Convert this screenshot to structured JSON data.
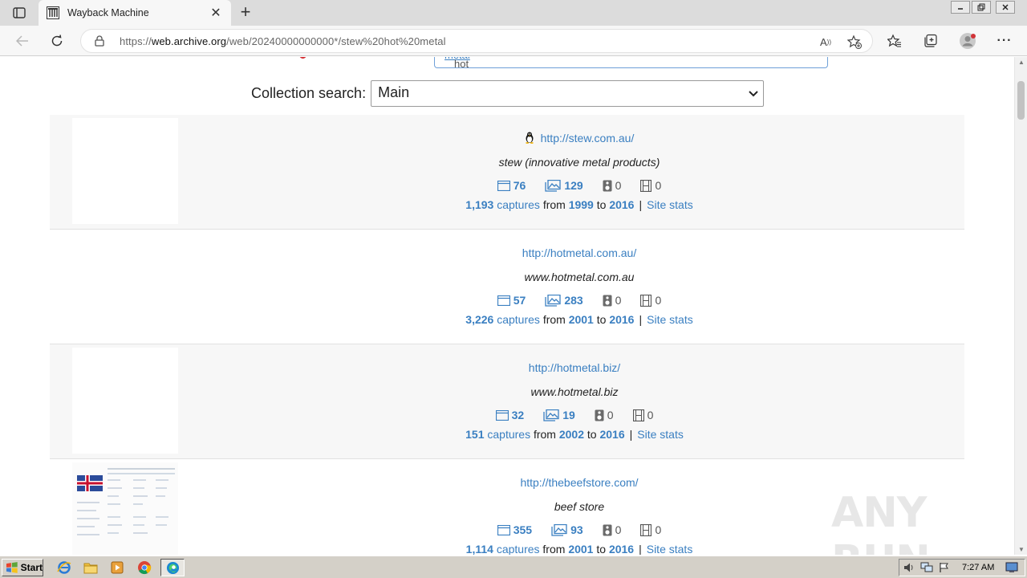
{
  "browser": {
    "tab_title": "Wayback Machine",
    "url_prefix": "https://",
    "url_host": "web.archive.org",
    "url_path": "/web/20240000000000*/stew%20hot%20metal"
  },
  "page": {
    "search_query_visible": "stew hot ",
    "search_query_underlined": "metal",
    "collection_label": "Collection search:",
    "collection_value": "Main"
  },
  "results": [
    {
      "url": "http://stew.com.au/",
      "title": "stew (innovative metal products)",
      "os_icon": "linux-penguin-icon",
      "html_pages": "76",
      "images": "129",
      "audio": "0",
      "video": "0",
      "captures": "1,193",
      "captures_word": "captures",
      "from_word": "from",
      "from_year": "1999",
      "to_word": "to",
      "to_year": "2016",
      "separator": "|",
      "site_stats": "Site stats"
    },
    {
      "url": "http://hotmetal.com.au/",
      "title": "www.hotmetal.com.au",
      "html_pages": "57",
      "images": "283",
      "audio": "0",
      "video": "0",
      "captures": "3,226",
      "captures_word": "captures",
      "from_word": "from",
      "from_year": "2001",
      "to_word": "to",
      "to_year": "2016",
      "separator": "|",
      "site_stats": "Site stats"
    },
    {
      "url": "http://hotmetal.biz/",
      "title": "www.hotmetal.biz",
      "html_pages": "32",
      "images": "19",
      "audio": "0",
      "video": "0",
      "captures": "151",
      "captures_word": "captures",
      "from_word": "from",
      "from_year": "2002",
      "to_word": "to",
      "to_year": "2016",
      "separator": "|",
      "site_stats": "Site stats"
    },
    {
      "url": "http://thebeefstore.com/",
      "title": "beef store",
      "html_pages": "355",
      "images": "93",
      "audio": "0",
      "video": "0",
      "captures": "1,114",
      "captures_word": "captures",
      "from_word": "from",
      "from_year": "2001",
      "to_word": "to",
      "to_year": "2016",
      "separator": "|",
      "site_stats": "Site stats"
    }
  ],
  "watermark": "ANY RUN",
  "taskbar": {
    "start_label": "Start",
    "clock": "7:27 AM"
  },
  "colors": {
    "link": "#3a7fc1",
    "alt_row": "#f7f7f7",
    "taskbar": "#d4d0c8"
  }
}
